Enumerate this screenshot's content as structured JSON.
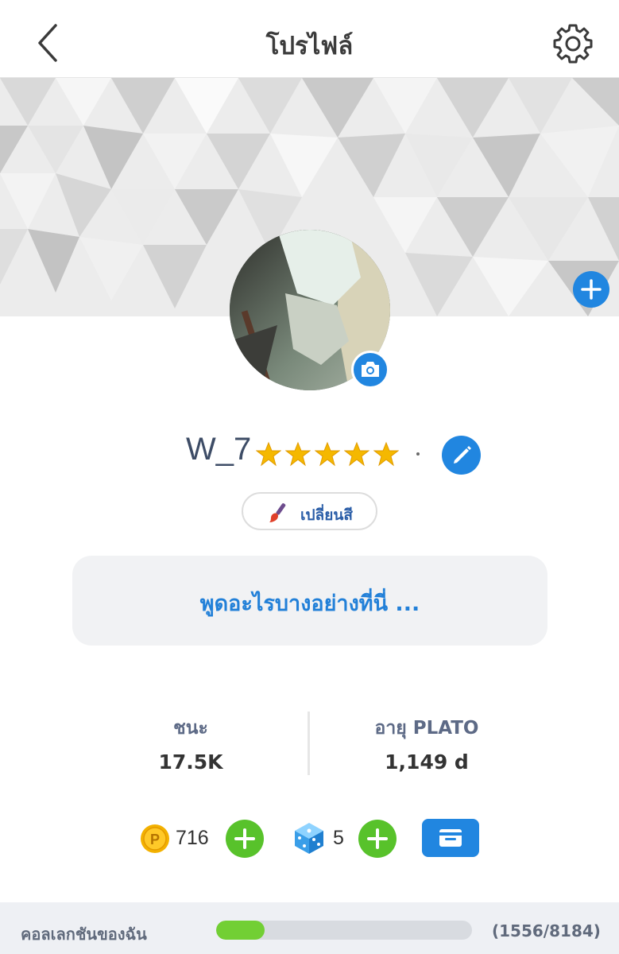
{
  "header": {
    "title": "โปรไฟล์",
    "back_icon": "chevron-left-icon",
    "settings_icon": "gear-icon"
  },
  "banner": {
    "add_icon": "plus-icon"
  },
  "avatar": {
    "camera_icon": "camera-icon"
  },
  "profile": {
    "username": "W_7",
    "star_count": 5,
    "edit_icon": "pencil-icon",
    "change_color_label": "เปลี่ยนสี",
    "status_placeholder": "พูดอะไรบางอย่างที่นี่ ..."
  },
  "stats": {
    "wins_label": "ชนะ",
    "wins_value": "17.5K",
    "age_label": "อายุ PLATO",
    "age_value": "1,149 d"
  },
  "currency": {
    "coins": "716",
    "dice": "5",
    "wallet_icon": "wallet-icon"
  },
  "collection": {
    "label": "คอลเลกชันของฉัน",
    "count_text": "(1556/8184)",
    "progress": 0.19
  },
  "colors": {
    "accent_blue": "#2186e0",
    "green": "#58c22b",
    "progress_green": "#72cf34",
    "star_gold": "#f5b800"
  }
}
